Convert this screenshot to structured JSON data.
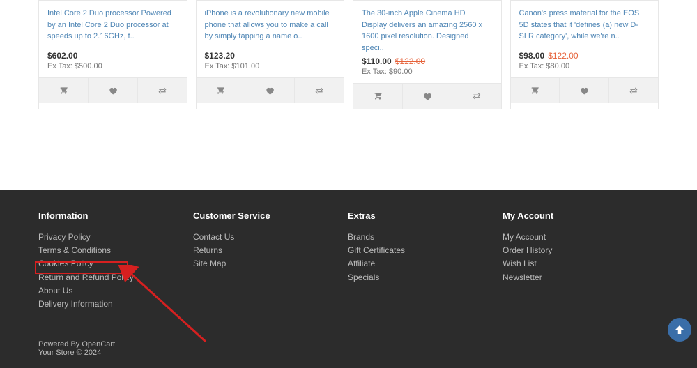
{
  "colors": {
    "accent": "#e6633b",
    "highlight": "#d62020"
  },
  "products": [
    {
      "desc": "Intel Core 2 Duo processor Powered by an Intel Core 2 Duo processor at speeds up to 2.16GHz, t..",
      "price": "$602.00",
      "old": "",
      "extax": "Ex Tax: $500.00"
    },
    {
      "desc": "iPhone is a revolutionary new mobile phone that allows you to make a call by simply tapping a name o..",
      "price": "$123.20",
      "old": "",
      "extax": "Ex Tax: $101.00"
    },
    {
      "desc": "The 30-inch Apple Cinema HD Display delivers an amazing 2560 x 1600 pixel resolution. Designed speci..",
      "price": "$110.00",
      "old": "$122.00",
      "extax": "Ex Tax: $90.00"
    },
    {
      "desc": "Canon's press material for the EOS 5D states that it 'defines (a) new D-SLR category', while we're n..",
      "price": "$98.00",
      "old": "$122.00",
      "extax": "Ex Tax: $80.00"
    }
  ],
  "footer": {
    "info": {
      "title": "Information",
      "links": [
        "Privacy Policy",
        "Terms & Conditions",
        "Cookies Policy",
        "Return and Refund Policy",
        "About Us",
        "Delivery Information"
      ]
    },
    "service": {
      "title": "Customer Service",
      "links": [
        "Contact Us",
        "Returns",
        "Site Map"
      ]
    },
    "extras": {
      "title": "Extras",
      "links": [
        "Brands",
        "Gift Certificates",
        "Affiliate",
        "Specials"
      ]
    },
    "account": {
      "title": "My Account",
      "links": [
        "My Account",
        "Order History",
        "Wish List",
        "Newsletter"
      ]
    },
    "powered_prefix": "Powered By ",
    "powered_link": "OpenCart",
    "copyright": "Your Store © 2024"
  }
}
